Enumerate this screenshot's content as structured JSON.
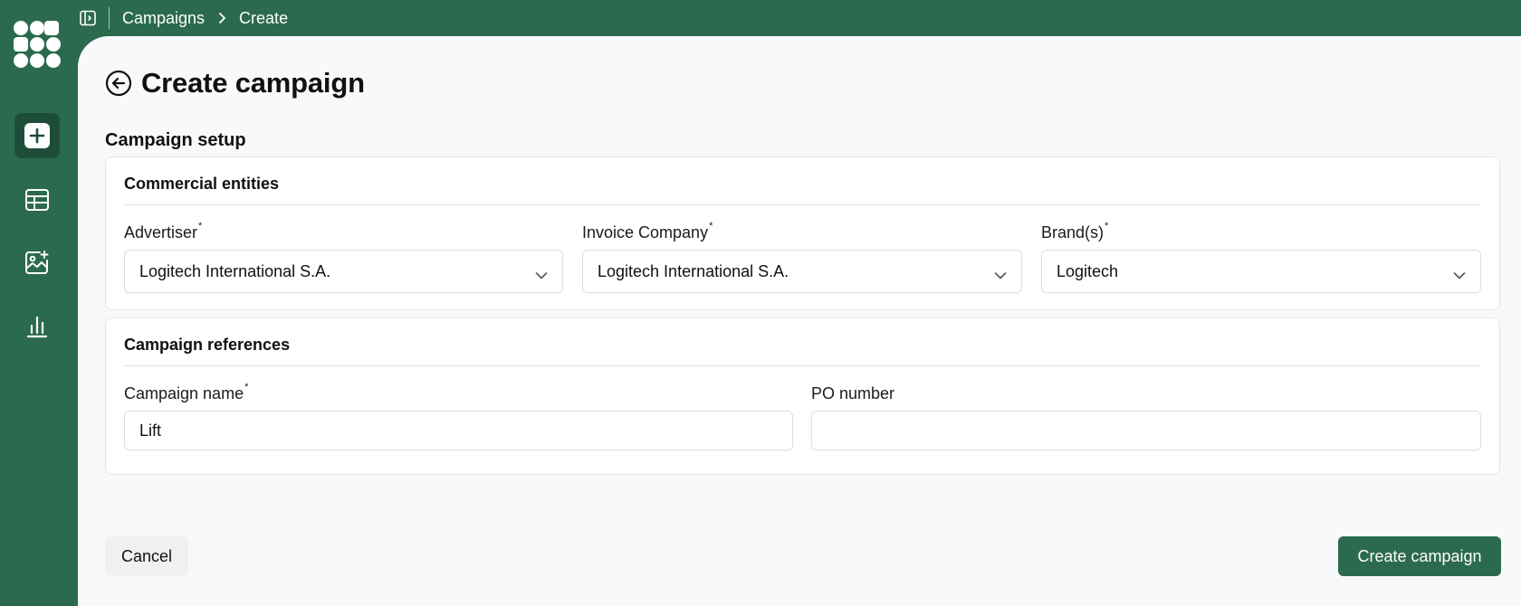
{
  "app": {
    "accent_color": "#2b6a4f"
  },
  "sidebar": {
    "logo_icon": "app-logo-grid",
    "items": [
      {
        "name": "create",
        "icon": "plus-square-icon",
        "active": true
      },
      {
        "name": "table",
        "icon": "table-icon",
        "active": false
      },
      {
        "name": "media",
        "icon": "image-plus-icon",
        "active": false
      },
      {
        "name": "analytics",
        "icon": "bar-chart-icon",
        "active": false
      }
    ]
  },
  "topbar": {
    "panel_icon": "sidebar-toggle-icon",
    "breadcrumb": [
      "Campaigns",
      "Create"
    ]
  },
  "page": {
    "title": "Create campaign",
    "section_title": "Campaign setup"
  },
  "commercial_entities": {
    "title": "Commercial entities",
    "advertiser": {
      "label": "Advertiser",
      "required_mark": "*",
      "value": "Logitech International S.A."
    },
    "invoice_company": {
      "label": "Invoice Company",
      "required_mark": "*",
      "value": "Logitech International S.A."
    },
    "brands": {
      "label": "Brand(s)",
      "required_mark": "*",
      "value": "Logitech"
    }
  },
  "campaign_references": {
    "title": "Campaign references",
    "campaign_name": {
      "label": "Campaign name",
      "required_mark": "*",
      "value": "Lift"
    },
    "po_number": {
      "label": "PO number",
      "value": ""
    }
  },
  "actions": {
    "cancel_label": "Cancel",
    "create_label": "Create campaign"
  }
}
